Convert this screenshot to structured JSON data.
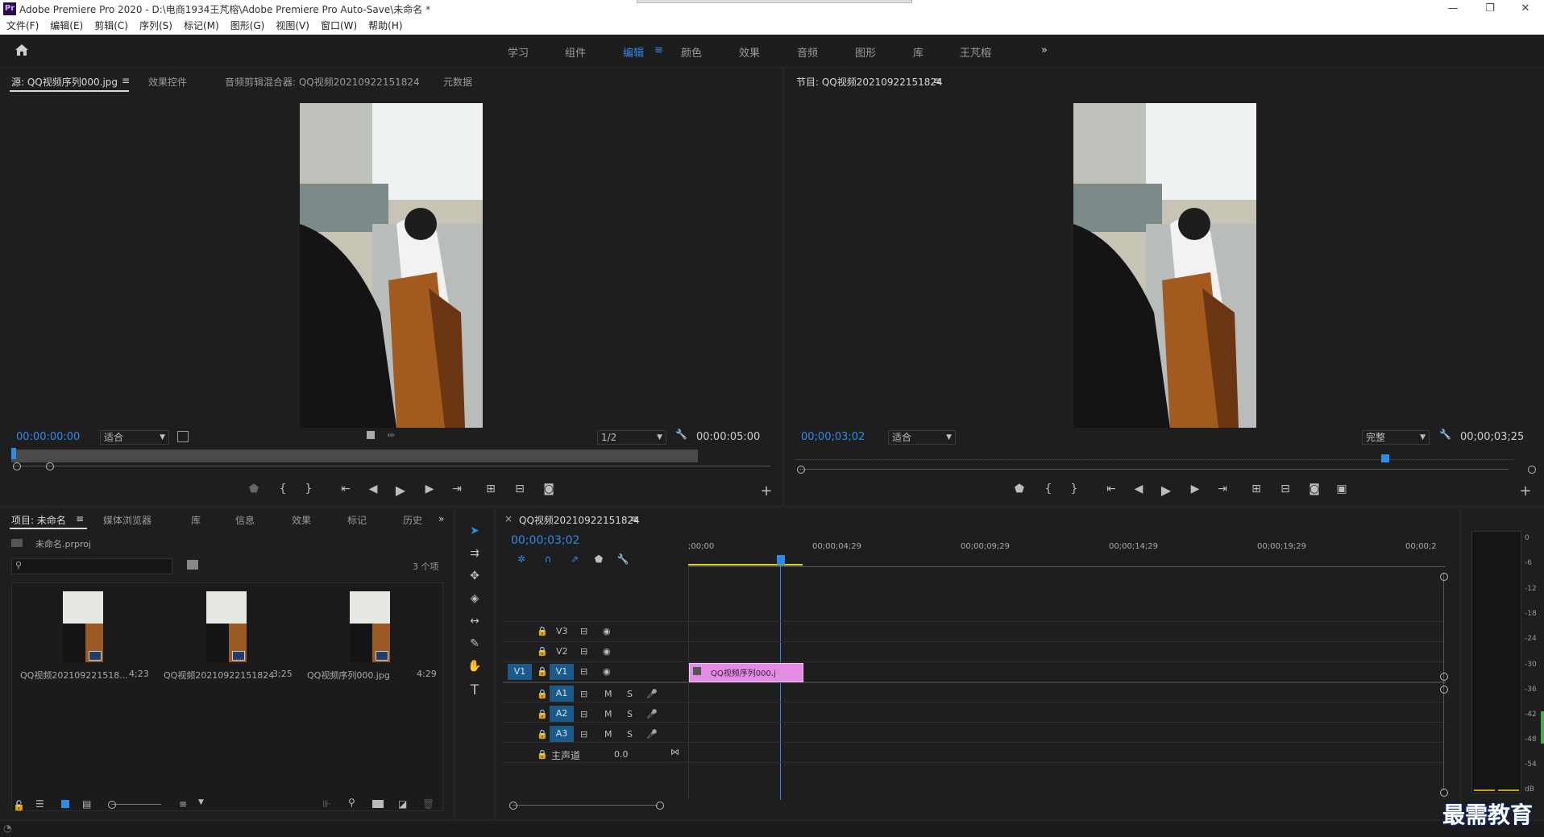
{
  "window": {
    "app_title": "Adobe Premiere Pro 2020 - D:\\电商1934王芃榕\\Adobe Premiere Pro Auto-Save\\未命名 *",
    "app_icon_text": "Pr",
    "minimize": "—",
    "restore": "❐",
    "close": "✕"
  },
  "menu": [
    "文件(F)",
    "编辑(E)",
    "剪辑(C)",
    "序列(S)",
    "标记(M)",
    "图形(G)",
    "视图(V)",
    "窗口(W)",
    "帮助(H)"
  ],
  "workspaces": [
    "学习",
    "组件",
    "编辑",
    "颜色",
    "效果",
    "音频",
    "图形",
    "库",
    "王芃榕"
  ],
  "workspace_menu_icon": "≡",
  "workspace_more": "»",
  "source": {
    "tabs": [
      "源: QQ视频序列000.jpg",
      "效果控件",
      "音频剪辑混合器: QQ视频20210922151824",
      "元数据"
    ],
    "tab_menu_icon": "≡",
    "timecode": "00:00:00:00",
    "fit": "适合",
    "resolution": "1/2",
    "duration": "00:00:05:00"
  },
  "program": {
    "title": "节目: QQ视频20210922151824",
    "menu_icon": "≡",
    "timecode": "00;00;03;02",
    "fit": "适合",
    "quality": "完整",
    "duration": "00;00;03;25"
  },
  "project": {
    "tabs": [
      "项目: 未命名",
      "媒体浏览器",
      "库",
      "信息",
      "效果",
      "标记",
      "历史"
    ],
    "menu_icon": "≡",
    "more": "»",
    "file": "未命名.prproj",
    "search_placeholder": "",
    "count": "3 个项",
    "items": [
      {
        "name": "QQ视频202109221518...",
        "duration": "4;23"
      },
      {
        "name": "QQ视频20210922151824",
        "duration": "3;25"
      },
      {
        "name": "QQ视频序列000.jpg",
        "duration": "4:29"
      }
    ]
  },
  "timeline": {
    "close": "×",
    "title": "QQ视频20210922151824",
    "menu_icon": "≡",
    "timecode": "00;00;03;02",
    "ruler": [
      ";00;00",
      "00;00;04;29",
      "00;00;09;29",
      "00;00;14;29",
      "00;00;19;29",
      "00;00;2"
    ],
    "video_tracks": [
      "V3",
      "V2",
      "V1"
    ],
    "source_patch": "V1",
    "audio_tracks": [
      "A1",
      "A2",
      "A3"
    ],
    "mute": "M",
    "solo": "S",
    "master": "主声道",
    "master_value": "0.0",
    "clip_label": "QQ视频序列000.j"
  },
  "meter": {
    "labels": [
      "0",
      "-6",
      "-12",
      "-18",
      "-24",
      "-30",
      "-36",
      "-42",
      "-48",
      "-54",
      "dB"
    ]
  },
  "watermark": "最需教育",
  "colors": {
    "accent": "#2d8ceb",
    "clip": "#e38ce3",
    "track_blue": "#1c5a8a",
    "workarea": "#e5d11f"
  }
}
